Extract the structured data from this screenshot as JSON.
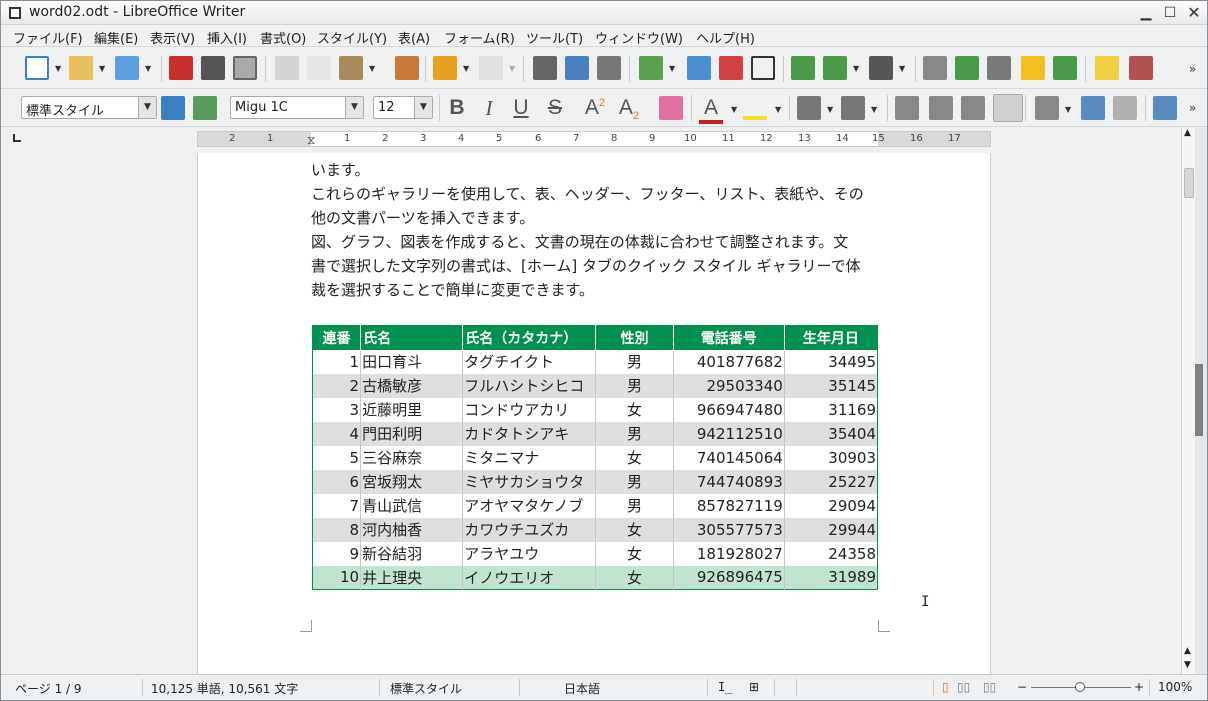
{
  "window": {
    "title": "word02.odt - LibreOffice Writer"
  },
  "menu": {
    "items": [
      "ファイル(F)",
      "編集(E)",
      "表示(V)",
      "挿入(I)",
      "書式(O)",
      "スタイル(Y)",
      "表(A)",
      "フォーム(R)",
      "ツール(T)",
      "ウィンドウ(W)",
      "ヘルプ(H)"
    ]
  },
  "format_bar": {
    "paragraph_style": "標準スタイル",
    "font_name": "Migu 1C",
    "font_size": "12"
  },
  "ruler": {
    "labels": [
      "2",
      "1",
      "1",
      "2",
      "3",
      "4",
      "5",
      "6",
      "7",
      "8",
      "9",
      "10",
      "11",
      "12",
      "13",
      "14",
      "15",
      "16",
      "17"
    ]
  },
  "document": {
    "paragraphs": [
      "います。",
      "これらのギャラリーを使用して、表、ヘッダー、フッター、リスト、表紙や、その",
      "他の文書パーツを挿入できます。",
      "図、グラフ、図表を作成すると、文書の現在の体裁に合わせて調整されます。文",
      "書で選択した文字列の書式は、[ホーム] タブのクイック スタイル ギャラリーで体",
      "裁を選択することで簡単に変更できます。"
    ],
    "table": {
      "headers": [
        "連番",
        "氏名",
        "氏名（カタカナ）",
        "性別",
        "電話番号",
        "生年月日"
      ],
      "rows": [
        [
          "1",
          "田口育斗",
          "タグチイクト",
          "男",
          "401877682",
          "34495"
        ],
        [
          "2",
          "古橋敏彦",
          "フルハシトシヒコ",
          "男",
          "29503340",
          "35145"
        ],
        [
          "3",
          "近藤明里",
          "コンドウアカリ",
          "女",
          "966947480",
          "31169"
        ],
        [
          "4",
          "門田利明",
          "カドタトシアキ",
          "男",
          "942112510",
          "35404"
        ],
        [
          "5",
          "三谷麻奈",
          "ミタニマナ",
          "女",
          "740145064",
          "30903"
        ],
        [
          "6",
          "宮坂翔太",
          "ミヤサカショウタ",
          "男",
          "744740893",
          "25227"
        ],
        [
          "7",
          "青山武信",
          "アオヤマタケノブ",
          "男",
          "857827119",
          "29094"
        ],
        [
          "8",
          "河内柚香",
          "カワウチユズカ",
          "女",
          "305577573",
          "29944"
        ],
        [
          "9",
          "新谷結羽",
          "アラヤユウ",
          "女",
          "181928027",
          "24358"
        ],
        [
          "10",
          "井上理央",
          "イノウエリオ",
          "女",
          "926896475",
          "31989"
        ]
      ]
    }
  },
  "status": {
    "page": "ページ 1 / 9",
    "words": "10,125 単語, 10,561 文字",
    "style": "標準スタイル",
    "language": "日本語",
    "zoom": "100%",
    "zoom_level_percent": 100
  },
  "colors": {
    "table_header": "#00904f",
    "even_row": "#dedede",
    "selected_row": "#c0e4cf"
  }
}
